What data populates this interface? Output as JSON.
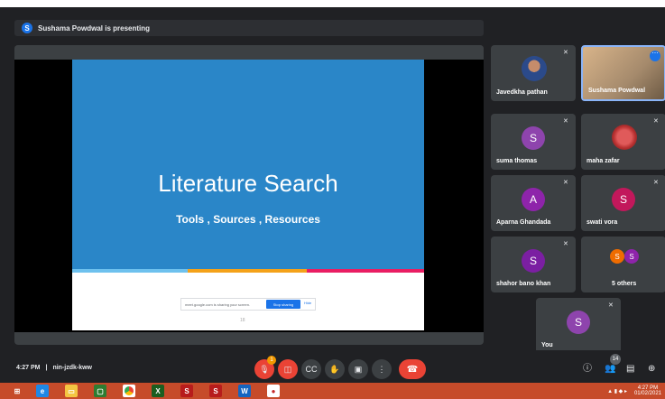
{
  "presenter": {
    "badge": "S",
    "text": "Sushama Powdwal is presenting"
  },
  "slide": {
    "title": "Literature Search",
    "subtitle": "Tools , Sources , Resources",
    "share_notice": "meet.google.com is sharing your screen.",
    "stop_label": "Stop sharing",
    "hide_label": "Hide",
    "page": "18"
  },
  "participants": [
    {
      "name": "Javedkha pathan"
    },
    {
      "name": "Sushama Powdwal"
    },
    {
      "name": "suma thomas",
      "initial": "S",
      "color": "#8e44ad"
    },
    {
      "name": "maha zafar"
    },
    {
      "name": "Aparna Ghandada",
      "initial": "A",
      "color": "#8e24aa"
    },
    {
      "name": "swati vora",
      "initial": "S",
      "color": "#c2185b"
    },
    {
      "name": "shahor bano khan",
      "initial": "S",
      "color": "#7b1fa2"
    },
    {
      "name": "5 others",
      "initials": [
        "S",
        "S"
      ]
    },
    {
      "name": "You",
      "initial": "S",
      "color": "#8e44ad"
    }
  ],
  "meeting": {
    "time": "4:27 PM",
    "separator": "|",
    "code": "nin-jzdk-kww",
    "people_count": "14",
    "mic_badge": "1"
  },
  "taskbar": {
    "time": "4:27 PM",
    "date": "01/02/2021"
  },
  "icons": {
    "mic": "mic-off-icon",
    "camera": "camera-off-icon",
    "captions": "captions-icon",
    "hand": "raise-hand-icon",
    "present": "present-icon",
    "more": "more-options-icon",
    "end": "end-call-icon",
    "info": "info-icon",
    "people": "people-icon",
    "chat": "chat-icon",
    "activities": "activities-icon"
  }
}
